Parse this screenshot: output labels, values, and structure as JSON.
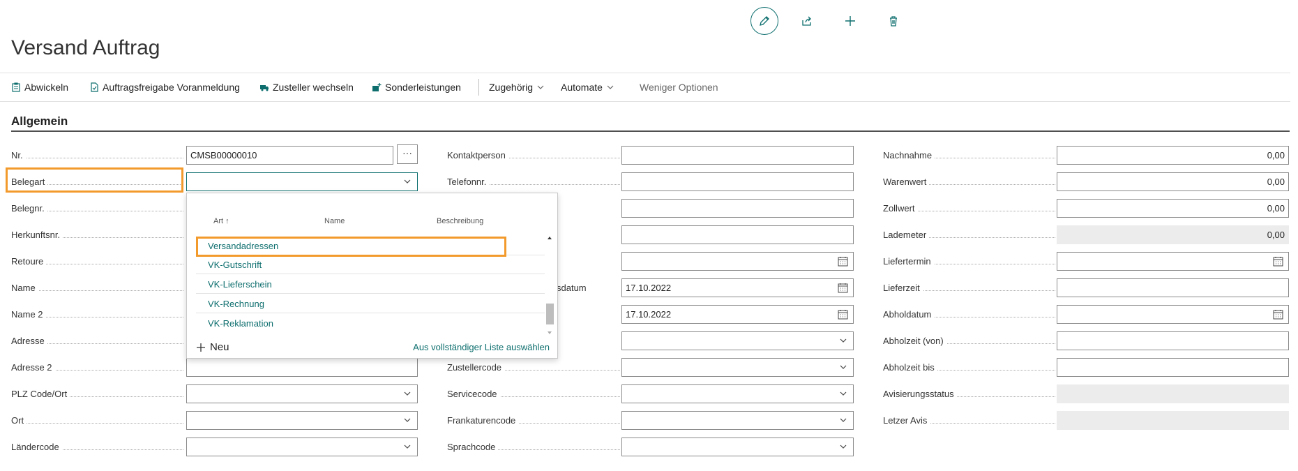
{
  "page": {
    "title": "Versand Auftrag"
  },
  "top_icons": [
    "edit-icon",
    "share-icon",
    "add-icon",
    "delete-icon"
  ],
  "actions": {
    "abwickeln": "Abwickeln",
    "freigabe": "Auftragsfreigabe Voranmeldung",
    "zusteller": "Zusteller wechseln",
    "sonderleistungen": "Sonderleistungen",
    "zugehoerig": "Zugehörig",
    "automate": "Automate",
    "weniger": "Weniger Optionen"
  },
  "section": {
    "title": "Allgemein"
  },
  "col1": {
    "nr": {
      "label": "Nr.",
      "value": "CMSB00000010",
      "more": "···"
    },
    "belegart": {
      "label": "Belegart",
      "value": ""
    },
    "belegnr": {
      "label": "Belegnr."
    },
    "herkunftsnr": {
      "label": "Herkunftsnr."
    },
    "retoure": {
      "label": "Retoure"
    },
    "name": {
      "label": "Name"
    },
    "name2": {
      "label": "Name 2"
    },
    "adresse": {
      "label": "Adresse"
    },
    "adresse2": {
      "label": "Adresse 2",
      "value": ""
    },
    "plz": {
      "label": "PLZ Code/Ort",
      "value": ""
    },
    "ort": {
      "label": "Ort",
      "value": ""
    },
    "laendercode": {
      "label": "Ländercode",
      "value": ""
    }
  },
  "col2": {
    "kontaktperson": {
      "label": "Kontaktperson",
      "value": ""
    },
    "telefonnr": {
      "label": "Telefonnr.",
      "value": ""
    },
    "datum1": {
      "label_partial": "sdatum",
      "value": "17.10.2022"
    },
    "datum2": {
      "value": "17.10.2022"
    },
    "zustellercode": {
      "label": "Zustellercode",
      "value": ""
    },
    "servicecode": {
      "label": "Servicecode",
      "value": ""
    },
    "frankaturencode": {
      "label": "Frankaturencode",
      "value": ""
    },
    "sprachcode": {
      "label": "Sprachcode",
      "value": ""
    }
  },
  "col3": {
    "nachnahme": {
      "label": "Nachnahme",
      "value": "0,00"
    },
    "warenwert": {
      "label": "Warenwert",
      "value": "0,00"
    },
    "zollwert": {
      "label": "Zollwert",
      "value": "0,00"
    },
    "lademeter": {
      "label": "Lademeter",
      "value": "0,00"
    },
    "liefertermin": {
      "label": "Liefertermin",
      "value": ""
    },
    "lieferzeit": {
      "label": "Lieferzeit",
      "value": ""
    },
    "abholdatum": {
      "label": "Abholdatum",
      "value": ""
    },
    "abholzeit_von": {
      "label": "Abholzeit (von)",
      "value": ""
    },
    "abholzeit_bis": {
      "label": "Abholzeit bis",
      "value": ""
    },
    "avisierungsstatus": {
      "label": "Avisierungsstatus",
      "value": ""
    },
    "letzer_avis": {
      "label": "Letzer Avis",
      "value": ""
    }
  },
  "dropdown": {
    "columns": {
      "art": "Art",
      "sort_indicator": "↑",
      "name": "Name",
      "beschreibung": "Beschreibung"
    },
    "rows": [
      "Versandadressen",
      "VK-Gutschrift",
      "VK-Lieferschein",
      "VK-Rechnung",
      "VK-Reklamation"
    ],
    "new_label": "Neu",
    "full_list_label": "Aus vollständiger Liste auswählen"
  },
  "colors": {
    "accent": "#0e6e6e",
    "highlight": "#f39a2d",
    "readonly_bg": "#ececec"
  }
}
